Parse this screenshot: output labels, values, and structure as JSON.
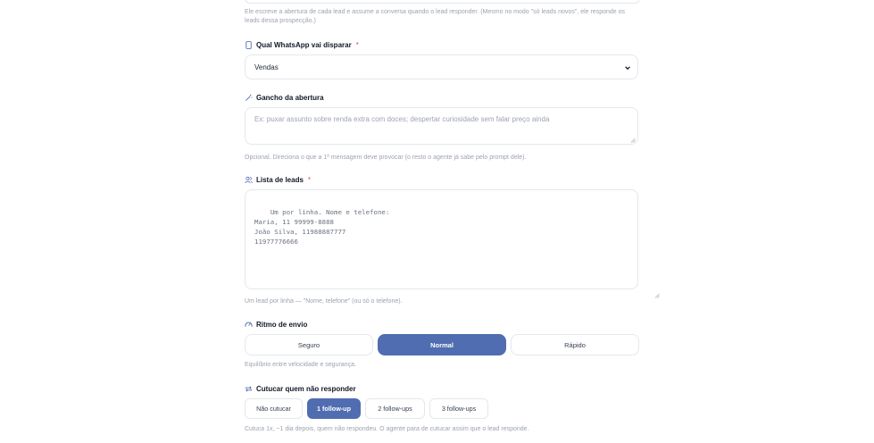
{
  "intro_help": "Ele escreve a abertura de cada lead e assume a conversa quando o lead responder. (Mesmo no modo \"só leads novos\", ele responde os leads dessa prospecção.)",
  "whatsapp": {
    "label": "Qual WhatsApp vai disparar",
    "required": "*",
    "icon": "phone-icon",
    "selected": "Vendas"
  },
  "gancho": {
    "label": "Gancho da abertura",
    "icon": "magic-wand-icon",
    "placeholder": "Ex: puxar assunto sobre renda extra com doces; despertar curiosidade sem falar preço ainda",
    "help": "Opcional. Direciona o que a 1ª mensagem deve provocar (o resto o agente já sabe pelo prompt dele)."
  },
  "leads": {
    "label": "Lista de leads",
    "required": "*",
    "icon": "users-icon",
    "placeholder": "Um por linha. Nome e telefone:\nMaria, 11 99999-8888\nJoão Silva, 11988887777\n11977776666",
    "help": "Um lead por linha — \"Nome, telefone\" (ou só o telefone)."
  },
  "ritmo": {
    "label": "Ritmo de envio",
    "icon": "gauge-icon",
    "options": [
      "Seguro",
      "Normal",
      "Rápido"
    ],
    "selected": "Normal",
    "help": "Equilíbrio entre velocidade e segurança."
  },
  "cutucar": {
    "label": "Cutucar quem não responder",
    "icon": "repeat-icon",
    "options": [
      "Não cutucar",
      "1 follow-up",
      "2 follow-ups",
      "3 follow-ups"
    ],
    "selected": "1 follow-up",
    "help": "Cutuca 1x, ~1 dia depois, quem não respondeu. O agente para de cutucar assim que o lead responde."
  },
  "colors": {
    "accent": "#4f6db0",
    "required": "#ef4444",
    "muted": "#9ca3af"
  }
}
